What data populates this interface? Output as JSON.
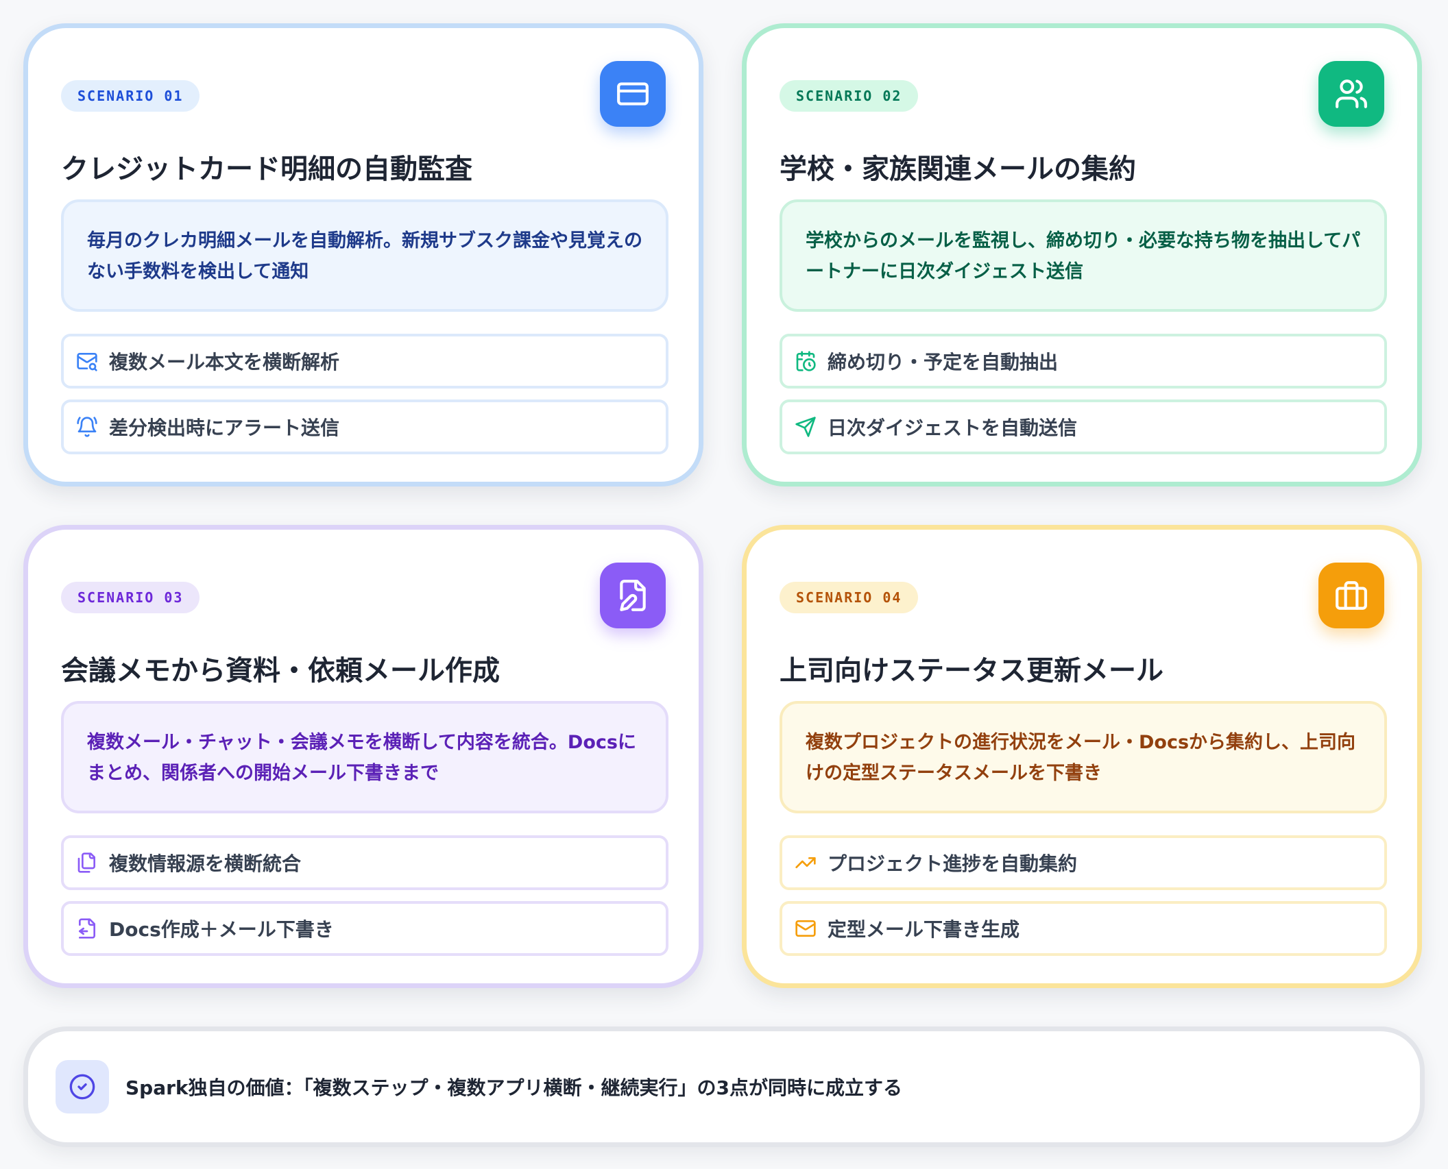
{
  "scenarios": [
    {
      "badge": "SCENARIO 01",
      "icon": "credit-card-icon",
      "title": "クレジットカード明細の自動監査",
      "description": "毎月のクレカ明細メールを自動解析。新規サブスク課金や見覚えのない手数料を検出して通知",
      "features": [
        {
          "icon": "mail-search-icon",
          "label": "複数メール本文を横断解析"
        },
        {
          "icon": "bell-icon",
          "label": "差分検出時にアラート送信"
        }
      ],
      "accent": "#3b82f6"
    },
    {
      "badge": "SCENARIO 02",
      "icon": "users-icon",
      "title": "学校・家族関連メールの集約",
      "description": "学校からのメールを監視し、締め切り・必要な持ち物を抽出してパートナーに日次ダイジェスト送信",
      "features": [
        {
          "icon": "calendar-clock-icon",
          "label": "締め切り・予定を自動抽出"
        },
        {
          "icon": "send-icon",
          "label": "日次ダイジェストを自動送信"
        }
      ],
      "accent": "#10b981"
    },
    {
      "badge": "SCENARIO 03",
      "icon": "file-pen-icon",
      "title": "会議メモから資料・依頼メール作成",
      "description": "複数メール・チャット・会議メモを横断して内容を統合。Docsにまとめ、関係者への開始メール下書きまで",
      "features": [
        {
          "icon": "files-icon",
          "label": "複数情報源を横断統合"
        },
        {
          "icon": "file-import-icon",
          "label": "Docs作成＋メール下書き"
        }
      ],
      "accent": "#8b5cf6"
    },
    {
      "badge": "SCENARIO 04",
      "icon": "briefcase-icon",
      "title": "上司向けステータス更新メール",
      "description": "複数プロジェクトの進行状況をメール・Docsから集約し、上司向けの定型ステータスメールを下書き",
      "features": [
        {
          "icon": "trending-up-icon",
          "label": "プロジェクト進捗を自動集約"
        },
        {
          "icon": "mail-icon",
          "label": "定型メール下書き生成"
        }
      ],
      "accent": "#f59e0b"
    }
  ],
  "footer": {
    "icon": "check-circle-icon",
    "text": "Spark独自の価値：「複数ステップ・複数アプリ横断・継続実行」の3点が同時に成立する"
  }
}
